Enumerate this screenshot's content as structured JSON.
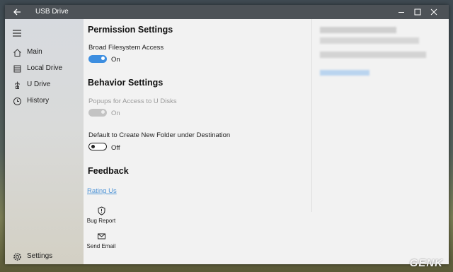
{
  "window": {
    "title": "USB Drive",
    "controls": [
      "minimize-icon",
      "maximize-icon",
      "close-icon"
    ]
  },
  "sidebar": {
    "items": [
      {
        "label": "Main",
        "icon": "home-icon"
      },
      {
        "label": "Local Drive",
        "icon": "drive-icon"
      },
      {
        "label": "U Drive",
        "icon": "usb-icon"
      },
      {
        "label": "History",
        "icon": "history-icon"
      }
    ],
    "settings": {
      "label": "Settings",
      "icon": "gear-icon"
    }
  },
  "permission": {
    "heading": "Permission Settings",
    "broad_access": {
      "label": "Broad Filesystem Access",
      "state": "On",
      "enabled": true,
      "on": true
    }
  },
  "behavior": {
    "heading": "Behavior Settings",
    "popups": {
      "label": "Popups for Access to U Disks",
      "state": "On",
      "enabled": false,
      "on": true
    },
    "new_folder": {
      "label": "Default to Create New Folder under Destination",
      "state": "Off",
      "enabled": true,
      "on": false
    }
  },
  "feedback": {
    "heading": "Feedback",
    "rating_link": "Rating Us",
    "bug_report": "Bug Report",
    "send_email": "Send Email"
  },
  "watermark": "GENK",
  "colors": {
    "accent": "#3d8ee0",
    "titlebar": "#4d5257",
    "link": "#4f94d6"
  }
}
